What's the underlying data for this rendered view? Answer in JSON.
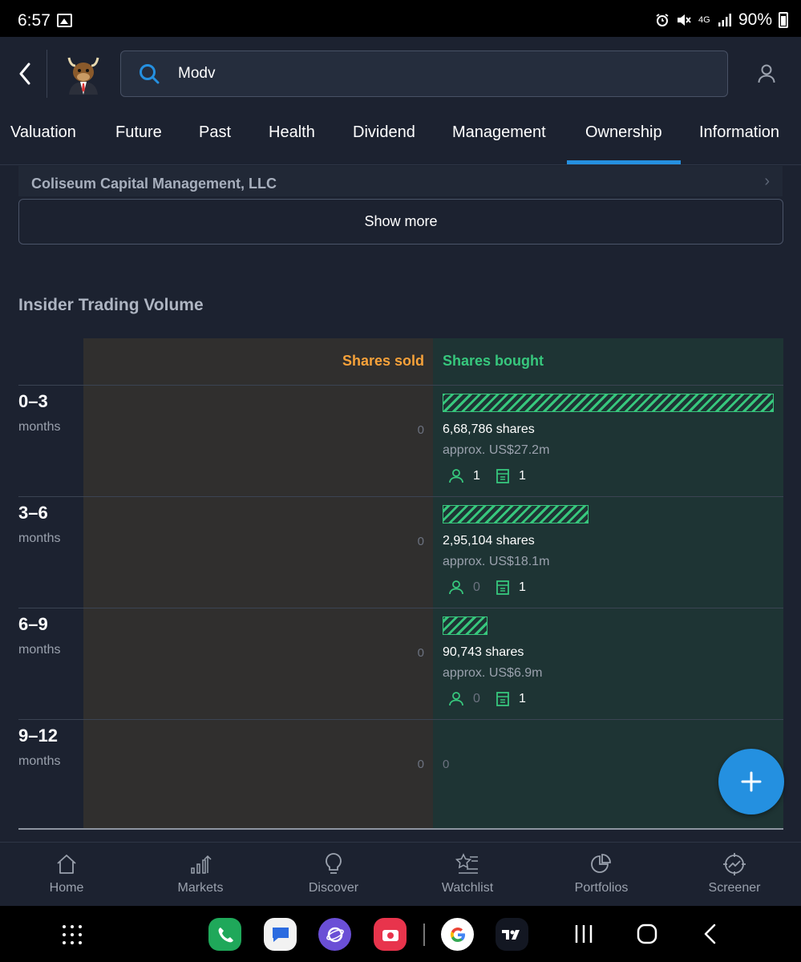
{
  "status_bar": {
    "time": "6:57",
    "network": "4G",
    "battery": "90%"
  },
  "app_bar": {
    "search_value": "Modv"
  },
  "tabs": [
    {
      "label": "Valuation"
    },
    {
      "label": "Future"
    },
    {
      "label": "Past"
    },
    {
      "label": "Health"
    },
    {
      "label": "Dividend"
    },
    {
      "label": "Management"
    },
    {
      "label": "Ownership",
      "active": true
    },
    {
      "label": "Information"
    }
  ],
  "ownership": {
    "last_holder": "Coliseum Capital Management, LLC",
    "show_more_label": "Show more"
  },
  "insider_trading": {
    "title": "Insider Trading Volume",
    "sold_header": "Shares sold",
    "bought_header": "Shares bought",
    "rows": [
      {
        "period": "0–3",
        "unit": "months",
        "sold": "0",
        "bought_shares": "6,68,786 shares",
        "bought_value": "approx. US$27.2m",
        "individuals": "1",
        "companies": "1",
        "bar_fraction": 1.0
      },
      {
        "period": "3–6",
        "unit": "months",
        "sold": "0",
        "bought_shares": "2,95,104 shares",
        "bought_value": "approx. US$18.1m",
        "individuals": "0",
        "companies": "1",
        "bar_fraction": 0.44
      },
      {
        "period": "6–9",
        "unit": "months",
        "sold": "0",
        "bought_shares": "90,743 shares",
        "bought_value": "approx. US$6.9m",
        "individuals": "0",
        "companies": "1",
        "bar_fraction": 0.136
      },
      {
        "period": "9–12",
        "unit": "months",
        "sold": "0",
        "bought_zero": "0"
      }
    ]
  },
  "bottom_nav": [
    {
      "label": "Home",
      "icon": "home-icon"
    },
    {
      "label": "Markets",
      "icon": "markets-icon"
    },
    {
      "label": "Discover",
      "icon": "lightbulb-icon"
    },
    {
      "label": "Watchlist",
      "icon": "watchlist-icon"
    },
    {
      "label": "Portfolios",
      "icon": "pie-chart-icon"
    },
    {
      "label": "Screener",
      "icon": "screener-icon"
    }
  ],
  "colors": {
    "background": "#1c2230",
    "accent": "#2590e0",
    "sold": "#f7a23a",
    "bought": "#37c77d"
  }
}
